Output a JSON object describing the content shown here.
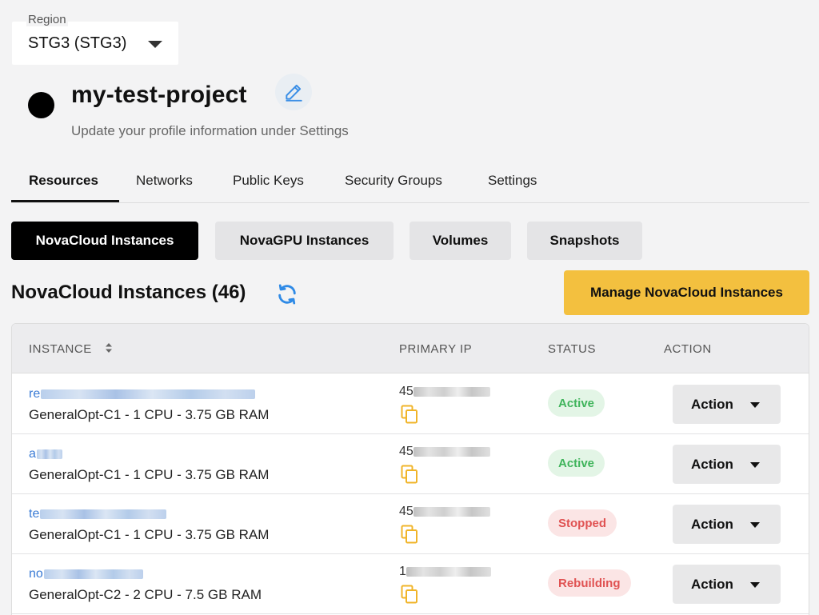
{
  "region": {
    "label": "Region",
    "value": "STG3 (STG3)"
  },
  "project": {
    "title": "my-test-project",
    "subtitle": "Update your profile information under Settings"
  },
  "tabs": [
    {
      "label": "Resources",
      "active": true
    },
    {
      "label": "Networks"
    },
    {
      "label": "Public Keys"
    },
    {
      "label": "Security Groups"
    },
    {
      "label": "Settings"
    }
  ],
  "subtabs": [
    {
      "label": "NovaCloud Instances",
      "active": true
    },
    {
      "label": "NovaGPU Instances"
    },
    {
      "label": "Volumes"
    },
    {
      "label": "Snapshots"
    }
  ],
  "section": {
    "title": "NovaCloud Instances (46)",
    "manage_label": "Manage NovaCloud Instances"
  },
  "table": {
    "headers": {
      "instance": "INSTANCE",
      "ip": "PRIMARY IP",
      "status": "STATUS",
      "action": "ACTION"
    },
    "rows": [
      {
        "name_prefix": "re",
        "spec": "GeneralOpt-C1 - 1 CPU - 3.75 GB RAM",
        "ip_prefix": "45",
        "status": "Active",
        "status_kind": "active",
        "action": "Action"
      },
      {
        "name_prefix": "a",
        "spec": "GeneralOpt-C1 - 1 CPU - 3.75 GB RAM",
        "ip_prefix": "45",
        "status": "Active",
        "status_kind": "active",
        "action": "Action"
      },
      {
        "name_prefix": "te",
        "spec": "GeneralOpt-C1 - 1 CPU - 3.75 GB RAM",
        "ip_prefix": "45",
        "status": "Stopped",
        "status_kind": "stopped",
        "action": "Action"
      },
      {
        "name_prefix": "no",
        "spec": "GeneralOpt-C2 - 2 CPU - 7.5 GB RAM",
        "ip_prefix": "1",
        "status": "Rebuilding",
        "status_kind": "rebuilding",
        "action": "Action"
      }
    ]
  },
  "icons": {
    "region_caret": "caret-down-icon",
    "edit": "pencil-icon",
    "refresh": "refresh-icon",
    "sort": "sort-icon",
    "copy": "copy-icon",
    "action_caret": "caret-down-icon"
  },
  "colors": {
    "accent_yellow": "#f3c03f",
    "link_blue": "#3a7bd5",
    "status_active": "#3fb45b",
    "status_error": "#e05252",
    "copy_icon": "#f0b429"
  }
}
